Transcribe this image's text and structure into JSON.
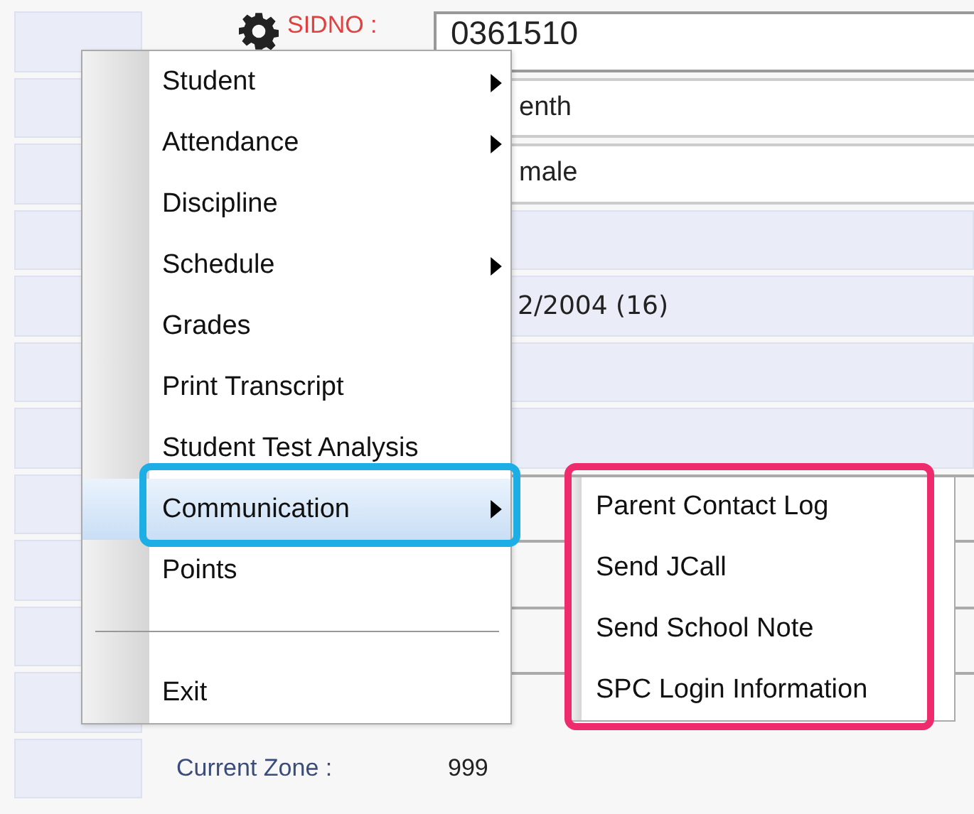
{
  "form": {
    "rows": [
      {
        "label": "SIDNO :",
        "value": "0361510",
        "kind": "input"
      },
      {
        "value": "enth",
        "kind": "input"
      },
      {
        "value": "male",
        "kind": "input"
      },
      {
        "value": "",
        "kind": "readonly"
      },
      {
        "value": "2/2004 (16)",
        "kind": "readonly"
      },
      {
        "value": "",
        "kind": "readonly"
      },
      {
        "value": "",
        "kind": "readonly"
      },
      {
        "value": "",
        "kind": "plain"
      },
      {
        "value": "",
        "kind": "plain"
      },
      {
        "value": "",
        "kind": "plain"
      },
      {
        "value": "",
        "kind": "plain"
      },
      {
        "label": "Current Zone :",
        "value": "999",
        "kind": "text"
      }
    ]
  },
  "context_menu": {
    "items": [
      {
        "label": "Student",
        "has_submenu": true,
        "selected": false
      },
      {
        "label": "Attendance",
        "has_submenu": true,
        "selected": false
      },
      {
        "label": "Discipline",
        "has_submenu": false,
        "selected": false
      },
      {
        "label": "Schedule",
        "has_submenu": true,
        "selected": false
      },
      {
        "label": "Grades",
        "has_submenu": false,
        "selected": false
      },
      {
        "label": "Print Transcript",
        "has_submenu": false,
        "selected": false
      },
      {
        "label": "Student Test Analysis",
        "has_submenu": false,
        "selected": false
      },
      {
        "label": "Communication",
        "has_submenu": true,
        "selected": true
      },
      {
        "label": "Points",
        "has_submenu": false,
        "selected": false
      },
      {
        "kind": "separator"
      },
      {
        "label": "Exit",
        "has_submenu": false,
        "selected": false
      }
    ]
  },
  "submenu": {
    "items": [
      {
        "label": "Parent Contact Log"
      },
      {
        "label": "Send JCall"
      },
      {
        "label": "Send School Note"
      },
      {
        "label": "SPC Login Information"
      }
    ]
  },
  "annotations": [
    {
      "kind": "item_frame",
      "color": "#1eaee6"
    },
    {
      "kind": "submenu_frame",
      "color": "#ee2b6c"
    }
  ]
}
